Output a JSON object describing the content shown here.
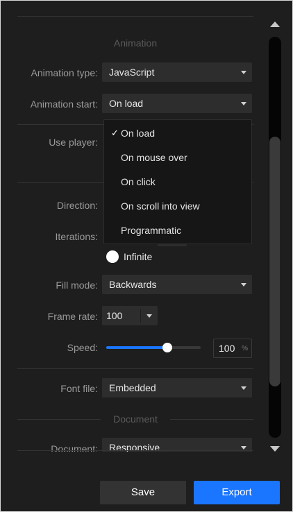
{
  "sections": {
    "animation_title": "Animation",
    "document_title": "Document"
  },
  "fields": {
    "animation_type": {
      "label": "Animation type:",
      "value": "JavaScript"
    },
    "animation_start": {
      "label": "Animation start:",
      "value": "On load"
    },
    "use_player": {
      "label": "Use player:"
    },
    "direction": {
      "label": "Direction:"
    },
    "iterations": {
      "label": "Iterations:",
      "infinite_label": "Infinite"
    },
    "fill_mode": {
      "label": "Fill mode:",
      "value": "Backwards"
    },
    "frame_rate": {
      "label": "Frame rate:",
      "value": "100"
    },
    "speed": {
      "label": "Speed:",
      "value": "100",
      "unit": "%",
      "slider_level": 0.65
    },
    "font_file": {
      "label": "Font file:",
      "value": "Embedded"
    },
    "document": {
      "label": "Document:",
      "value": "Responsive"
    }
  },
  "dropdown": {
    "check": "✓",
    "options": [
      "On load",
      "On mouse over",
      "On click",
      "On scroll into view",
      "Programmatic"
    ],
    "selected_index": 0
  },
  "buttons": {
    "save": "Save",
    "export": "Export"
  },
  "colors": {
    "accent": "#1a75ff",
    "background": "#1e1e1e",
    "control": "#2d2d2d"
  }
}
